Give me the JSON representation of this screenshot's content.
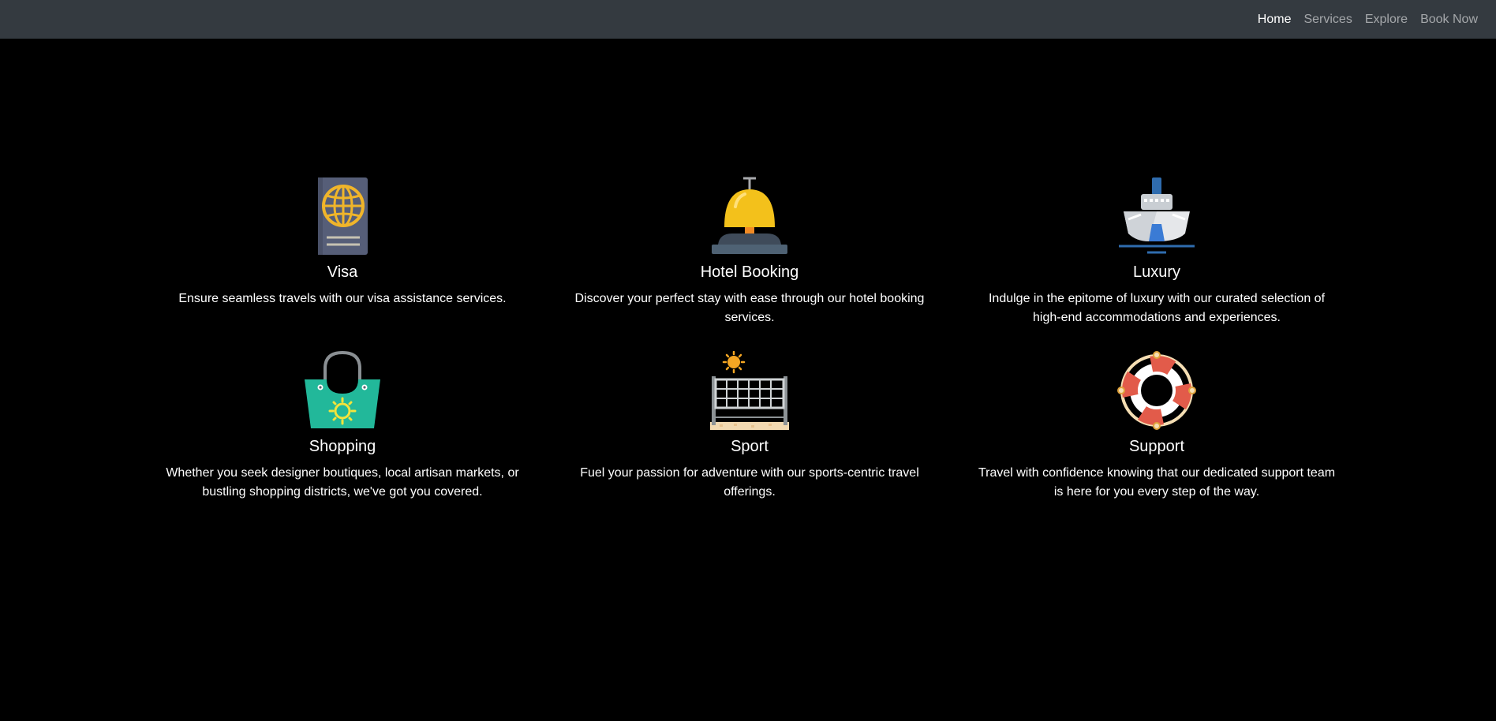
{
  "nav": {
    "items": [
      {
        "label": "Home",
        "active": true
      },
      {
        "label": "Services",
        "active": false
      },
      {
        "label": "Explore",
        "active": false
      },
      {
        "label": "Book Now",
        "active": false
      }
    ]
  },
  "services": [
    {
      "icon": "passport-icon",
      "title": "Visa",
      "description": "Ensure seamless travels with our visa assistance services."
    },
    {
      "icon": "service-bell-icon",
      "title": "Hotel Booking",
      "description": "Discover your perfect stay with ease through our hotel booking services."
    },
    {
      "icon": "cruise-ship-icon",
      "title": "Luxury",
      "description": "Indulge in the epitome of luxury with our curated selection of high-end accommodations and experiences."
    },
    {
      "icon": "shopping-bag-icon",
      "title": "Shopping",
      "description": "Whether you seek designer boutiques, local artisan markets, or bustling shopping districts, we've got you covered."
    },
    {
      "icon": "sport-net-icon",
      "title": "Sport",
      "description": "Fuel your passion for adventure with our sports-centric travel offerings."
    },
    {
      "icon": "lifebuoy-icon",
      "title": "Support",
      "description": "Travel with confidence knowing that our dedicated support team is here for you every step of the way."
    }
  ],
  "colors": {
    "navbar": "#343a40",
    "background": "#000000",
    "text": "#ffffff",
    "nav_inactive": "rgba(255,255,255,0.55)"
  }
}
